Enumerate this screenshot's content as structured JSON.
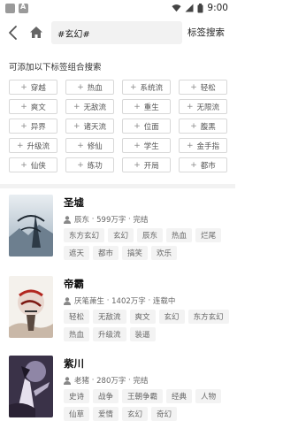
{
  "status_bar": {
    "time": "9:00"
  },
  "header": {
    "search_value": "#玄幻#",
    "search_button_label": "标签搜索"
  },
  "section_title": "可添加以下标签组合搜索",
  "tags": [
    "穿越",
    "热血",
    "系统流",
    "轻松",
    "爽文",
    "无敌流",
    "重生",
    "无限流",
    "异界",
    "诸天流",
    "位面",
    "腹黑",
    "升级流",
    "修仙",
    "学生",
    "金手指",
    "仙侠",
    "练功",
    "开局",
    "都市"
  ],
  "books": [
    {
      "title": "圣墟",
      "author": "辰东",
      "words": "599万字",
      "status": "完结",
      "tags": [
        "东方玄幻",
        "玄幻",
        "辰东",
        "热血",
        "烂尾",
        "遮天",
        "都市",
        "搞笑",
        "欢乐"
      ]
    },
    {
      "title": "帝霸",
      "author": "厌笔萧生",
      "words": "1402万字",
      "status": "连载中",
      "tags": [
        "轻松",
        "无敌流",
        "爽文",
        "玄幻",
        "东方玄幻",
        "热血",
        "升级流",
        "装逼"
      ]
    },
    {
      "title": "紫川",
      "author": "老猪",
      "words": "280万字",
      "status": "完结",
      "tags": [
        "史诗",
        "战争",
        "王朝争霸",
        "经典",
        "人物",
        "仙草",
        "爱情",
        "玄幻",
        "奇幻"
      ]
    }
  ],
  "colors": {
    "icon_gray": "#666666",
    "tag_border": "#d8d8d8",
    "tag_fill": "#f3f3f3"
  }
}
